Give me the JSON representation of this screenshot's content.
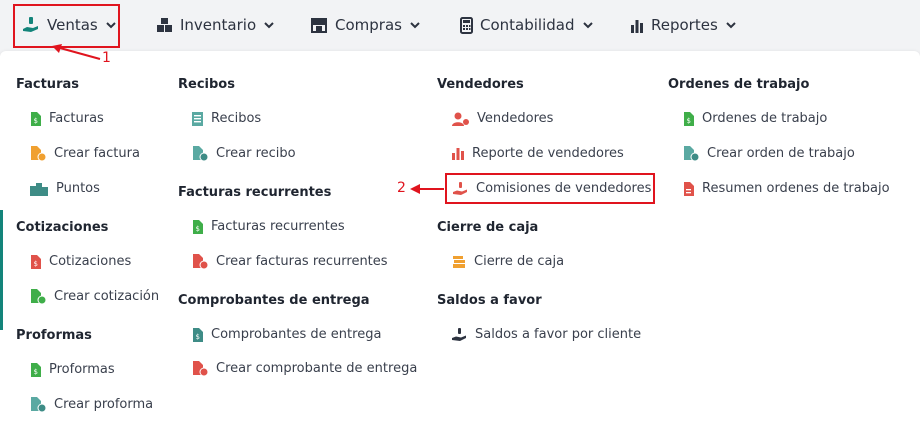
{
  "nav": {
    "ventas": "Ventas",
    "inventario": "Inventario",
    "compras": "Compras",
    "contabilidad": "Contabilidad",
    "reportes": "Reportes"
  },
  "annotations": {
    "one": "1",
    "two": "2"
  },
  "menu": {
    "facturas": {
      "title": "Facturas",
      "items": [
        "Facturas",
        "Crear factura",
        "Puntos"
      ]
    },
    "cotizaciones": {
      "title": "Cotizaciones",
      "items": [
        "Cotizaciones",
        "Crear cotización"
      ]
    },
    "proformas": {
      "title": "Proformas",
      "items": [
        "Proformas",
        "Crear proforma"
      ]
    },
    "recibos": {
      "title": "Recibos",
      "items": [
        "Recibos",
        "Crear recibo"
      ]
    },
    "facturas_recurrentes": {
      "title": "Facturas recurrentes",
      "items": [
        "Facturas recurrentes",
        "Crear facturas recurrentes"
      ]
    },
    "comprobantes": {
      "title": "Comprobantes de entrega",
      "items": [
        "Comprobantes de entrega",
        "Crear comprobante de entrega"
      ]
    },
    "vendedores": {
      "title": "Vendedores",
      "items": [
        "Vendedores",
        "Reporte de vendedores",
        "Comisiones de vendedores"
      ]
    },
    "cierre": {
      "title": "Cierre de caja",
      "items": [
        "Cierre de caja"
      ]
    },
    "saldos": {
      "title": "Saldos a favor",
      "items": [
        "Saldos a favor por cliente"
      ]
    },
    "ordenes": {
      "title": "Ordenes de trabajo",
      "items": [
        "Ordenes de trabajo",
        "Crear orden de trabajo",
        "Resumen ordenes de trabajo"
      ]
    }
  },
  "colors": {
    "accent": "#13847a",
    "highlight": "#e0141e",
    "icon_green": "#3fae49",
    "icon_orange": "#f0a030",
    "icon_teal": "#3e8c86",
    "icon_red": "#e0524a",
    "icon_gray": "#5aa9a2"
  }
}
